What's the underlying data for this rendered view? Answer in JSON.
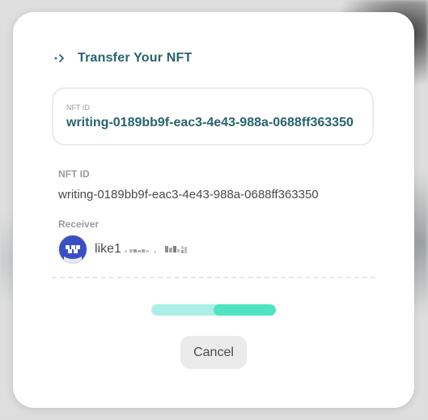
{
  "dialog": {
    "title": "Transfer Your NFT",
    "title_icon": "chevron-right-dotted-icon",
    "id_card": {
      "label": "NFT ID",
      "value": "writing-0189bb9f-eac3-4e43-988a-0688ff363350"
    },
    "nft_id": {
      "label": "NFT ID",
      "value": "writing-0189bb9f-eac3-4e43-988a-0688ff363350"
    },
    "receiver": {
      "label": "Receiver",
      "address_prefix": "like1",
      "avatar_icon": "identicon-avatar"
    },
    "progress": {
      "fill_start_percent": 50,
      "fill_end_percent": 100,
      "colors": {
        "track": "#aaf0e6",
        "fill": "#50e3c2"
      }
    },
    "cancel_label": "Cancel"
  },
  "colors": {
    "brand": "#28646e",
    "muted": "#9b9b9b",
    "text": "#4a4a4a"
  }
}
